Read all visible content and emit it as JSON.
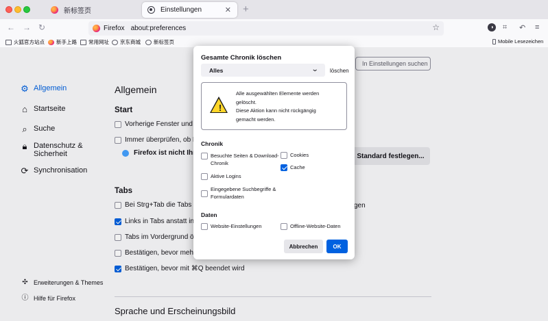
{
  "tabs": [
    {
      "label": "新标签页",
      "icon": "firefox-icon"
    },
    {
      "label": "Einstellungen",
      "icon": "gear-icon"
    }
  ],
  "urlbar": {
    "identity": "Firefox",
    "url": "about:preferences"
  },
  "bookmarks": [
    {
      "label": "火狐官方站点",
      "icon": "folder-icon"
    },
    {
      "label": "新手上路",
      "icon": "firefox-icon"
    },
    {
      "label": "常用网址",
      "icon": "folder-icon"
    },
    {
      "label": "京东商城",
      "icon": "globe-icon"
    },
    {
      "label": "新标签页",
      "icon": "globe-icon"
    }
  ],
  "bookmarks_mobile": "Mobile Lesezeichen",
  "search": {
    "placeholder": "In Einstellungen suchen"
  },
  "sidebar": {
    "items": [
      {
        "label": "Allgemein",
        "icon": "gear-icon"
      },
      {
        "label": "Startseite",
        "icon": "home-icon"
      },
      {
        "label": "Suche",
        "icon": "search-icon"
      },
      {
        "label": "Datenschutz &",
        "label2": "Sicherheit",
        "icon": "lock-icon"
      },
      {
        "label": "Synchronisation",
        "icon": "sync-icon"
      }
    ],
    "bottom": [
      {
        "label": "Erweiterungen & Themes",
        "icon": "puzzle-icon"
      },
      {
        "label": "Hilfe für Firefox",
        "icon": "help-icon"
      }
    ]
  },
  "main": {
    "title": "Allgemein",
    "start_heading": "Start",
    "start_rows": [
      {
        "label": "Vorherige Fenster und T",
        "checked": false
      },
      {
        "label": "Immer überprüfen, ob F",
        "checked": false
      }
    ],
    "default_text": "Firefox ist nicht Ihr",
    "default_button": "s Standard festlegen...",
    "tabs_heading": "Tabs",
    "tabs_rows": [
      {
        "label": "Bei Strg+Tab die Tabs n",
        "suffix": "gen",
        "checked": false
      },
      {
        "label": "Links in Tabs anstatt in",
        "checked": true
      },
      {
        "label": "Tabs im Vordergrund öf",
        "checked": false
      },
      {
        "label": "Bestätigen, bevor mehre",
        "checked": false
      },
      {
        "label": "Bestätigen, bevor mit ⌘Q beendet wird",
        "checked": true
      }
    ],
    "language_heading": "Sprache und Erscheinungsbild"
  },
  "dialog": {
    "title": "Gesamte Chronik löschen",
    "range_value": "Alles",
    "range_label": "löschen",
    "warning_text": [
      "Alle ausgewählten Elemente werden",
      "gelöscht.",
      "Diese Aktion kann nicht rückgängig",
      "gemacht werden."
    ],
    "history_heading": "Chronik",
    "history_left": [
      {
        "label": "Besuchte Seiten & Download-Chronik",
        "checked": false
      },
      {
        "label": "Aktive Logins",
        "checked": false
      },
      {
        "label": "Eingegebene Suchbegriffe & Formulardaten",
        "checked": false
      }
    ],
    "history_right": [
      {
        "label": "Cookies",
        "checked": false
      },
      {
        "label": "Cache",
        "checked": true
      }
    ],
    "data_heading": "Daten",
    "data_items": [
      {
        "label": "Website-Einstellungen",
        "checked": false
      },
      {
        "label": "Offline-Website-Daten",
        "checked": false
      }
    ],
    "cancel_label": "Abbrechen",
    "ok_label": "OK"
  },
  "colors": {
    "accent": "#0061e0",
    "warning": "#ffd629"
  }
}
